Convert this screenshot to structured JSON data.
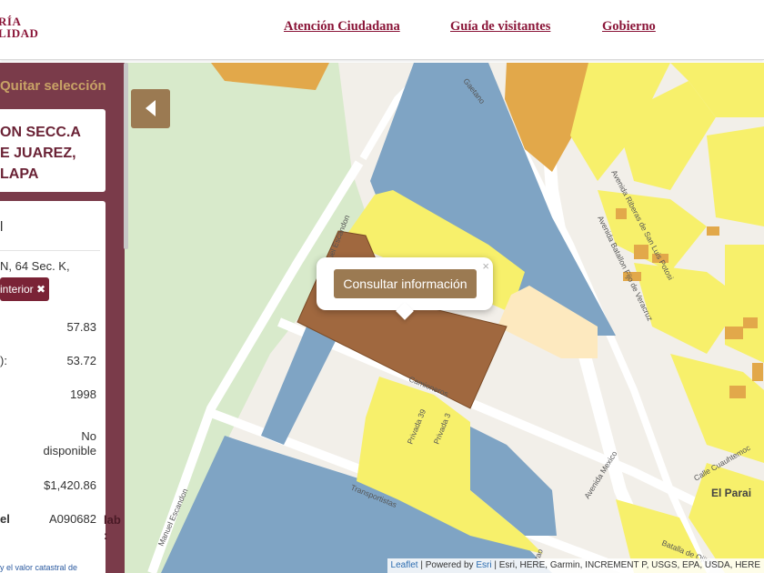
{
  "header": {
    "logo_line1": "RÍA",
    "logo_line2": "LIDAD",
    "nav": [
      "Atención Ciudadana",
      "Guía de visitantes",
      "Gobierno"
    ]
  },
  "sidebar": {
    "clear_selection": "Quitar selección",
    "address_lines": [
      "ON SECC.A",
      "E JUAREZ,",
      "LAPA"
    ],
    "details_heading": "l",
    "details_address": "N, 64 Sec. K,",
    "interior_button": "interior ✖",
    "rows": [
      {
        "label": "",
        "value": "57.83"
      },
      {
        "label": "):",
        "value": "53.72"
      },
      {
        "label": "",
        "value": "1998"
      },
      {
        "label": "",
        "value": "No disponible"
      },
      {
        "label": "",
        "value": "$1,420.86"
      },
      {
        "label": "el",
        "value": "A090682"
      }
    ],
    "side_overflow_text": "lab\n:",
    "footnote": "y el valor catastral de"
  },
  "map": {
    "collapse_icon": "chevron-left-icon",
    "popup_button": "Consultar información",
    "popup_close": "×",
    "attribution_leaflet": "Leaflet",
    "attribution_powered": " | Powered by ",
    "attribution_esri": "Esri",
    "attribution_rest": " | Esri, HERE, Garmin, INCREMENT P, USGS, EPA, USDA, HERE",
    "street_labels": {
      "manuel_escandon_n": "Manuel Escandon",
      "manuel_escandon_s": "Manuel Escandon",
      "camioneros": "Camioneros",
      "transportistas": "Transportistas",
      "privada_39": "Privada 39",
      "privada_3": "Privada 3",
      "av_mexico": "Avenida Mexico",
      "av_riberas": "Avenida Riberas de San Luis Potosi",
      "av_batallon": "Avenida Batallon Fijo de Veracruz",
      "calle_cuauhtemoc": "Calle Cuauhtemoc",
      "batalla_ojitos": "Batalla de Ojitos",
      "el_paraiso": "El Parai",
      "gaetano": "Gaetano",
      "tao": "tao"
    },
    "colors": {
      "brand": "#8a1538",
      "sidebar": "#7a3b4a",
      "accent": "#9b7a52",
      "selected_parcel": "#a0683f",
      "blue_parcel": "#7fa4c4",
      "yellow_parcel": "#f7f06b",
      "orange_parcel": "#e2a84a",
      "green_area": "#d8eacb"
    }
  }
}
